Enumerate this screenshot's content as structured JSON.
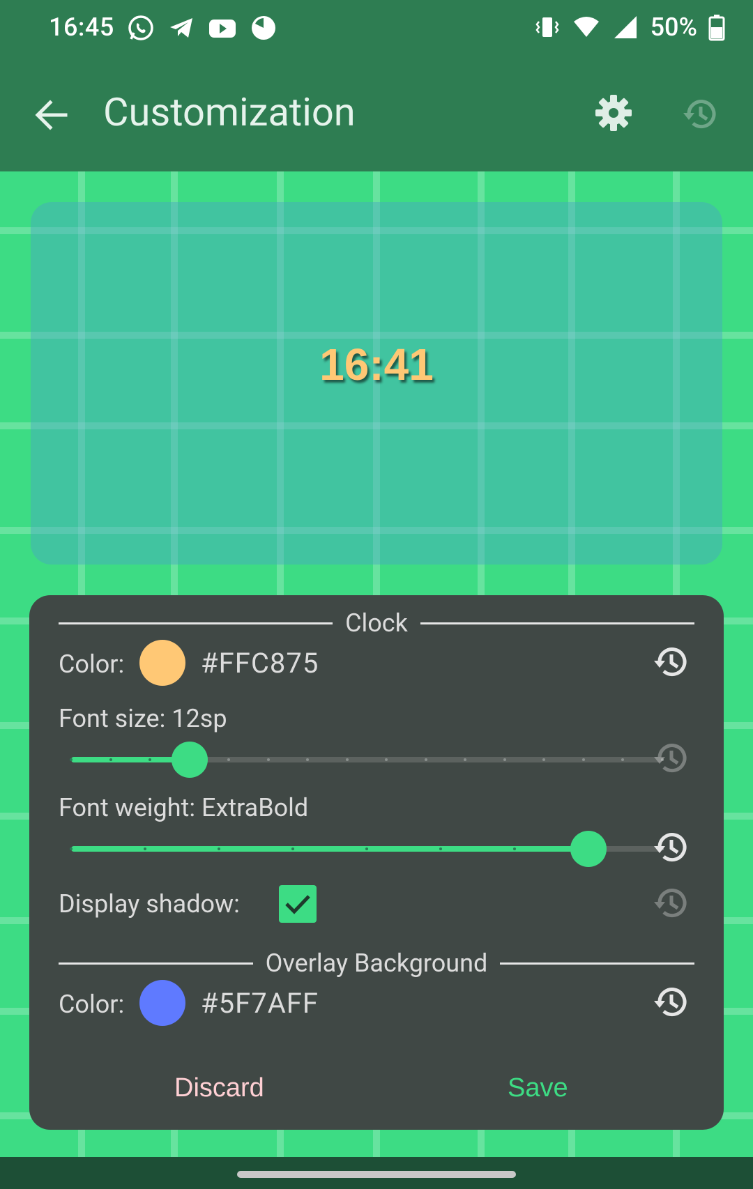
{
  "status_bar": {
    "time": "16:45",
    "battery": "50%",
    "left_icons": [
      "whatsapp-icon",
      "telegram-icon",
      "youtube-icon",
      "clock-app-icon"
    ],
    "right_icons": [
      "vibrate-icon",
      "wifi-icon",
      "signal-icon",
      "battery-icon"
    ]
  },
  "app_bar": {
    "title": "Customization",
    "icons": [
      "back-arrow-icon",
      "gear-icon",
      "history-icon"
    ]
  },
  "preview": {
    "clock_text": "16:41"
  },
  "panel": {
    "clock_section": {
      "title": "Clock",
      "color_label": "Color:",
      "color_hex": "#FFC875",
      "font_size_label": "Font size: 12sp",
      "font_size_level": 0.2,
      "font_weight_label": "Font weight: ExtraBold",
      "font_weight_level": 0.875,
      "shadow_label": "Display shadow:",
      "shadow_checked": true
    },
    "overlay_section": {
      "title": "Overlay Background",
      "color_label": "Color:",
      "color_hex": "#5F7AFF"
    },
    "buttons": {
      "discard": "Discard",
      "save": "Save"
    }
  },
  "colors": {
    "accent": "#3DDC84",
    "app_bar": "#2E7D52",
    "panel": "#404845",
    "clock_color": "#FFC875",
    "overlay_color": "#5F7AFF",
    "discard_text": "#FFD0D4"
  }
}
